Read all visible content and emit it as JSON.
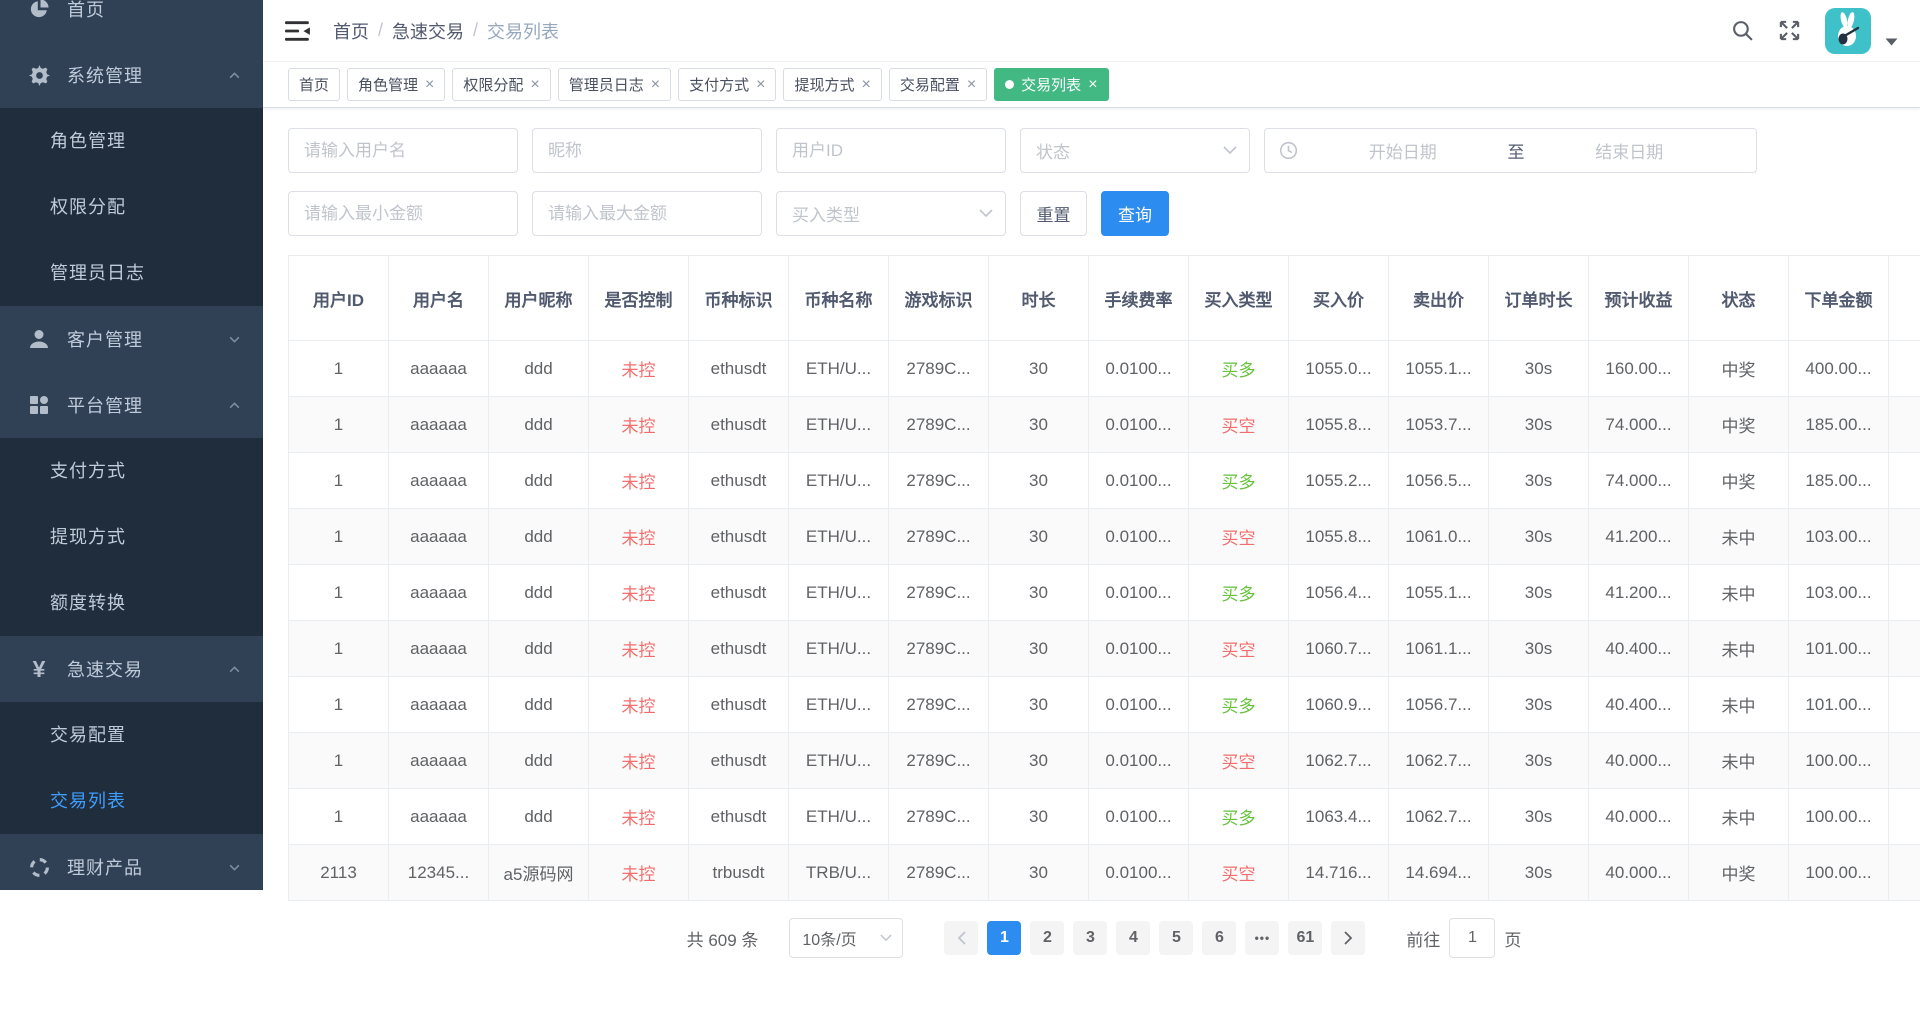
{
  "header": {
    "breadcrumb": [
      "首页",
      "急速交易",
      "交易列表"
    ]
  },
  "sidebar": {
    "items": [
      {
        "id": "home",
        "label": "首页",
        "icon": "dashboard-icon"
      },
      {
        "id": "system",
        "label": "系统管理",
        "icon": "gear-icon",
        "expanded": true,
        "children": [
          {
            "label": "角色管理"
          },
          {
            "label": "权限分配"
          },
          {
            "label": "管理员日志"
          }
        ]
      },
      {
        "id": "customer",
        "label": "客户管理",
        "icon": "user-icon",
        "expanded": false,
        "children": []
      },
      {
        "id": "platform",
        "label": "平台管理",
        "icon": "component-icon",
        "expanded": true,
        "children": [
          {
            "label": "支付方式"
          },
          {
            "label": "提现方式"
          },
          {
            "label": "额度转换"
          }
        ]
      },
      {
        "id": "fast-trade",
        "label": "急速交易",
        "icon": "yen-icon",
        "expanded": true,
        "children": [
          {
            "label": "交易配置"
          },
          {
            "label": "交易列表",
            "active": true
          }
        ]
      },
      {
        "id": "finance",
        "label": "理财产品",
        "icon": "ring-icon",
        "expanded": false,
        "children": []
      }
    ]
  },
  "tabs": [
    {
      "label": "首页",
      "closable": false,
      "active": false
    },
    {
      "label": "角色管理",
      "closable": true,
      "active": false
    },
    {
      "label": "权限分配",
      "closable": true,
      "active": false
    },
    {
      "label": "管理员日志",
      "closable": true,
      "active": false
    },
    {
      "label": "支付方式",
      "closable": true,
      "active": false
    },
    {
      "label": "提现方式",
      "closable": true,
      "active": false
    },
    {
      "label": "交易配置",
      "closable": true,
      "active": false
    },
    {
      "label": "交易列表",
      "closable": true,
      "active": true
    }
  ],
  "filters": {
    "username_placeholder": "请输入用户名",
    "nickname_placeholder": "昵称",
    "userid_placeholder": "用户ID",
    "status_placeholder": "状态",
    "date_start_placeholder": "开始日期",
    "date_separator": "至",
    "date_end_placeholder": "结束日期",
    "min_amount_placeholder": "请输入最小金额",
    "max_amount_placeholder": "请输入最大金额",
    "buy_type_placeholder": "买入类型",
    "reset_label": "重置",
    "search_label": "查询"
  },
  "table": {
    "columns": [
      "用户ID",
      "用户名",
      "用户昵称",
      "是否控制",
      "币种标识",
      "币种名称",
      "游戏标识",
      "时长",
      "手续费率",
      "买入类型",
      "买入价",
      "卖出价",
      "订单时长",
      "预计收益",
      "状态",
      "下单金额"
    ],
    "rows": [
      [
        "1",
        "aaaaaa",
        "ddd",
        "未控",
        "ethusdt",
        "ETH/U...",
        "2789C...",
        "30",
        "0.0100...",
        "买多",
        "1055.0...",
        "1055.1...",
        "30s",
        "160.00...",
        "中奖",
        "400.00..."
      ],
      [
        "1",
        "aaaaaa",
        "ddd",
        "未控",
        "ethusdt",
        "ETH/U...",
        "2789C...",
        "30",
        "0.0100...",
        "买空",
        "1055.8...",
        "1053.7...",
        "30s",
        "74.000...",
        "中奖",
        "185.00..."
      ],
      [
        "1",
        "aaaaaa",
        "ddd",
        "未控",
        "ethusdt",
        "ETH/U...",
        "2789C...",
        "30",
        "0.0100...",
        "买多",
        "1055.2...",
        "1056.5...",
        "30s",
        "74.000...",
        "中奖",
        "185.00..."
      ],
      [
        "1",
        "aaaaaa",
        "ddd",
        "未控",
        "ethusdt",
        "ETH/U...",
        "2789C...",
        "30",
        "0.0100...",
        "买空",
        "1055.8...",
        "1061.0...",
        "30s",
        "41.200...",
        "未中",
        "103.00..."
      ],
      [
        "1",
        "aaaaaa",
        "ddd",
        "未控",
        "ethusdt",
        "ETH/U...",
        "2789C...",
        "30",
        "0.0100...",
        "买多",
        "1056.4...",
        "1055.1...",
        "30s",
        "41.200...",
        "未中",
        "103.00..."
      ],
      [
        "1",
        "aaaaaa",
        "ddd",
        "未控",
        "ethusdt",
        "ETH/U...",
        "2789C...",
        "30",
        "0.0100...",
        "买空",
        "1060.7...",
        "1061.1...",
        "30s",
        "40.400...",
        "未中",
        "101.00..."
      ],
      [
        "1",
        "aaaaaa",
        "ddd",
        "未控",
        "ethusdt",
        "ETH/U...",
        "2789C...",
        "30",
        "0.0100...",
        "买多",
        "1060.9...",
        "1056.7...",
        "30s",
        "40.400...",
        "未中",
        "101.00..."
      ],
      [
        "1",
        "aaaaaa",
        "ddd",
        "未控",
        "ethusdt",
        "ETH/U...",
        "2789C...",
        "30",
        "0.0100...",
        "买空",
        "1062.7...",
        "1062.7...",
        "30s",
        "40.000...",
        "未中",
        "100.00..."
      ],
      [
        "1",
        "aaaaaa",
        "ddd",
        "未控",
        "ethusdt",
        "ETH/U...",
        "2789C...",
        "30",
        "0.0100...",
        "买多",
        "1063.4...",
        "1062.7...",
        "30s",
        "40.000...",
        "未中",
        "100.00..."
      ],
      [
        "2113",
        "12345...",
        "a5源码网",
        "未控",
        "trbusdt",
        "TRB/U...",
        "2789C...",
        "30",
        "0.0100...",
        "买空",
        "14.716...",
        "14.694...",
        "30s",
        "40.000...",
        "中奖",
        "100.00..."
      ]
    ]
  },
  "pagination": {
    "total_label": "共 609 条",
    "page_size_label": "10条/页",
    "pages": [
      "1",
      "2",
      "3",
      "4",
      "5",
      "6",
      "•••",
      "61"
    ],
    "active_page": "1",
    "jump_prefix": "前往",
    "jump_value": "1",
    "jump_suffix": "页"
  },
  "colors": {
    "sidebar_bg": "#304156",
    "submenu_bg": "#1f2d3d",
    "menu_active_blue": "#409eff",
    "accent_blue": "#2d8cf0",
    "tab_active_green": "#42b983",
    "danger_red": "#f56c6c",
    "success_green": "#67c23a",
    "avatar_teal": "#3fc1c9"
  }
}
